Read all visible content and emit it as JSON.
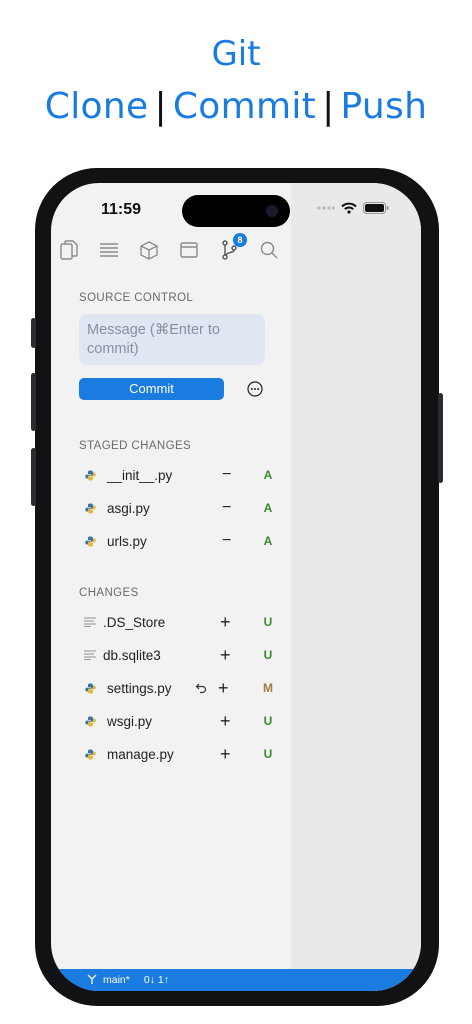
{
  "promo": {
    "title": "Git",
    "subtitle_parts": [
      "Clone",
      "Commit",
      "Push"
    ],
    "separator": "|"
  },
  "status_bar": {
    "time": "11:59"
  },
  "toolbar": {
    "icons": [
      "files-icon",
      "outline-icon",
      "package-icon",
      "browser-icon",
      "source-control-icon",
      "search-icon"
    ],
    "source_control_badge": "8"
  },
  "source_control": {
    "section_title": "SOURCE CONTROL",
    "message_placeholder": "Message (⌘Enter to commit)",
    "commit_label": "Commit"
  },
  "staged": {
    "section_title": "STAGED CHANGES",
    "files": [
      {
        "name": "__init__.py",
        "icon": "python-icon",
        "action": "−",
        "status": "A"
      },
      {
        "name": "asgi.py",
        "icon": "python-icon",
        "action": "−",
        "status": "A"
      },
      {
        "name": "urls.py",
        "icon": "python-icon",
        "action": "−",
        "status": "A"
      }
    ]
  },
  "changes": {
    "section_title": "CHANGES",
    "files": [
      {
        "name": ".DS_Store",
        "icon": "text-file-icon",
        "action": "+",
        "status": "U"
      },
      {
        "name": "db.sqlite3",
        "icon": "text-file-icon",
        "action": "+",
        "status": "U"
      },
      {
        "name": "settings.py",
        "icon": "python-icon",
        "action": "+",
        "status": "M",
        "has_discard": true
      },
      {
        "name": "wsgi.py",
        "icon": "python-icon",
        "action": "+",
        "status": "U"
      },
      {
        "name": "manage.py",
        "icon": "python-icon",
        "action": "+",
        "status": "U"
      }
    ]
  },
  "bottom_bar": {
    "branch": "main*",
    "sync": "0↓ 1↑"
  },
  "colors": {
    "accent": "#1a7be0",
    "added": "#3a8a2e",
    "modified": "#a07c3c"
  }
}
